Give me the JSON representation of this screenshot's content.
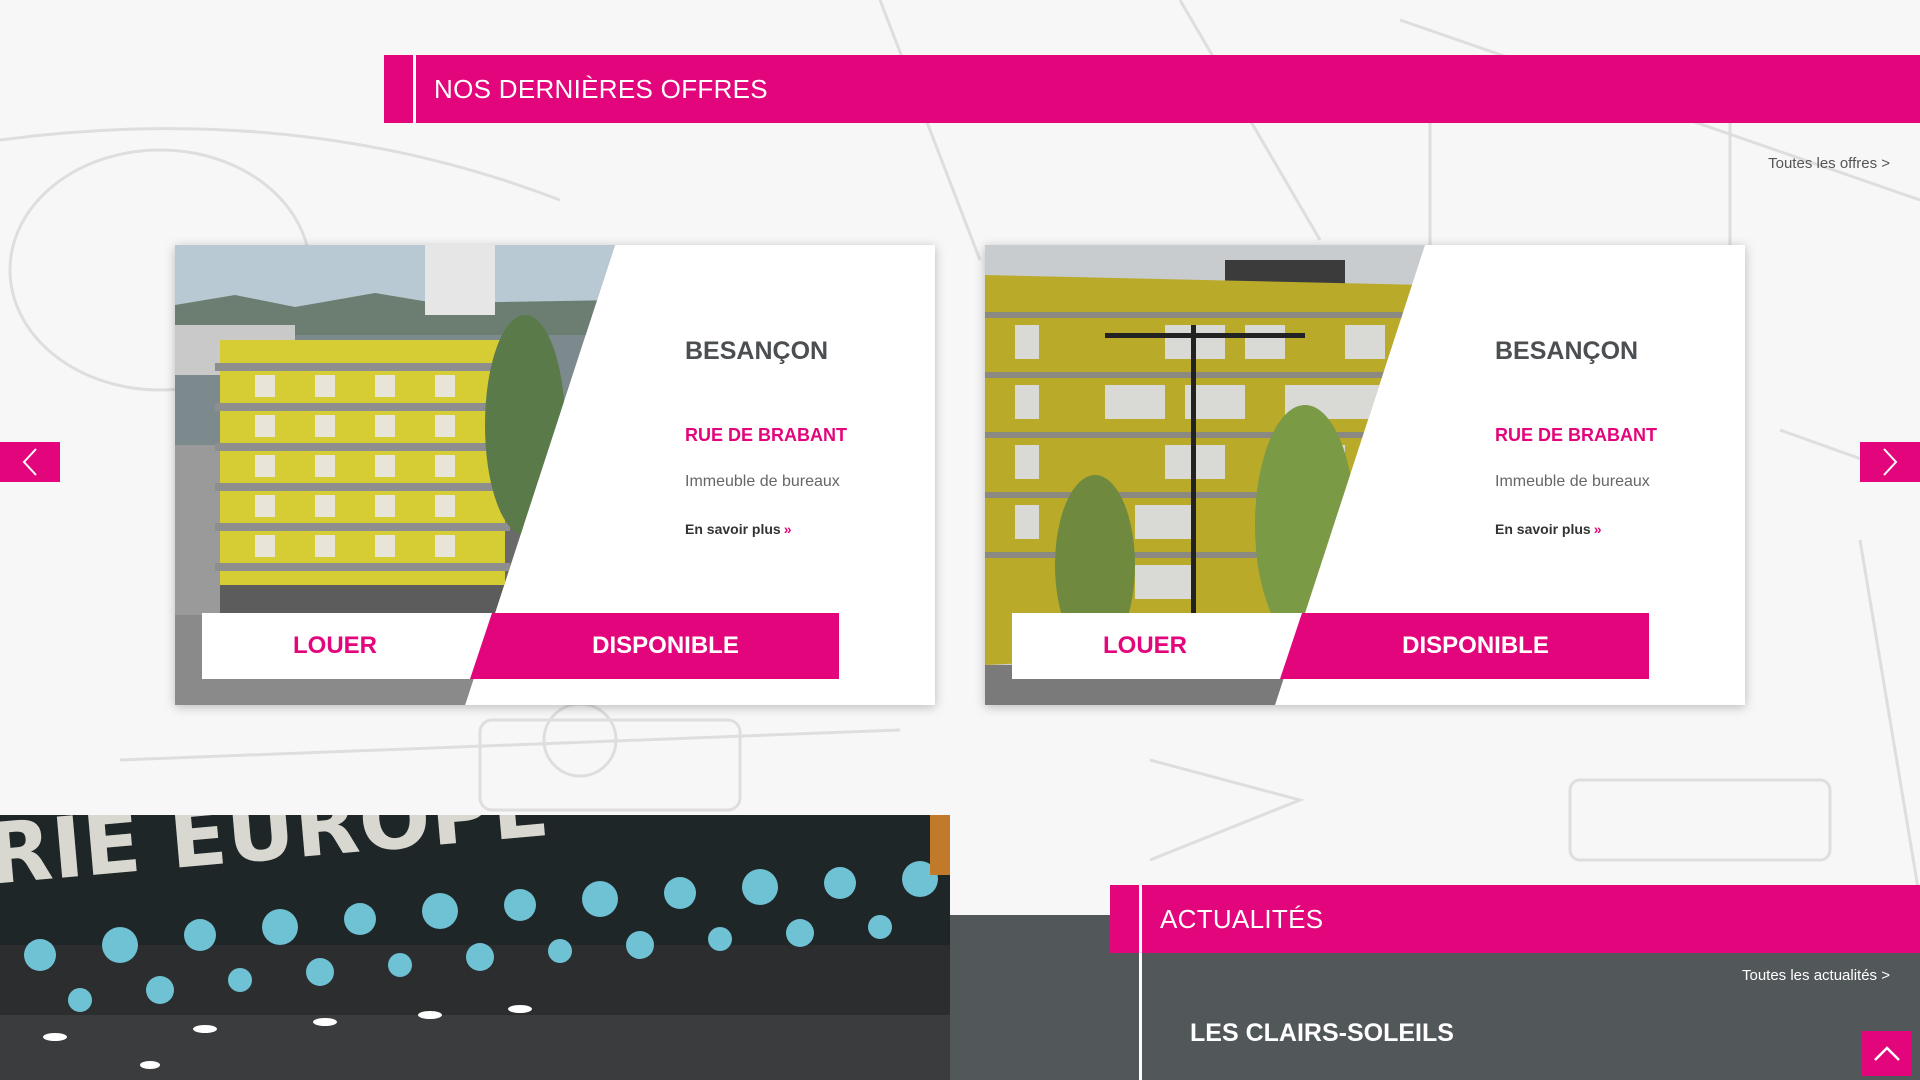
{
  "colors": {
    "accent": "#e2057b",
    "dark": "#52575a",
    "text": "#4b4f51"
  },
  "offers": {
    "section_title": "NOS DERNIÈRES OFFRES",
    "see_all": "Toutes les offres >",
    "prev_icon": "chevron-left-icon",
    "next_icon": "chevron-right-icon",
    "cards": [
      {
        "city": "BESANÇON",
        "street": "RUE DE BRABANT",
        "type": "Immeuble de bureaux",
        "more": "En savoir plus",
        "more_icon": "double-chevron-right-icon",
        "louer": "LOUER",
        "status": "DISPONIBLE"
      },
      {
        "city": "BESANÇON",
        "street": "RUE DE BRABANT",
        "type": "Immeuble de bureaux",
        "more": "En savoir plus",
        "more_icon": "double-chevron-right-icon",
        "louer": "LOUER",
        "status": "DISPONIBLE"
      }
    ]
  },
  "news": {
    "section_title": "ACTUALITÉS",
    "see_all": "Toutes les actualités >",
    "headline": "LES CLAIRS-SOLEILS",
    "photo_sign": "RIE EUROPE"
  },
  "back_to_top_icon": "chevron-up-icon"
}
